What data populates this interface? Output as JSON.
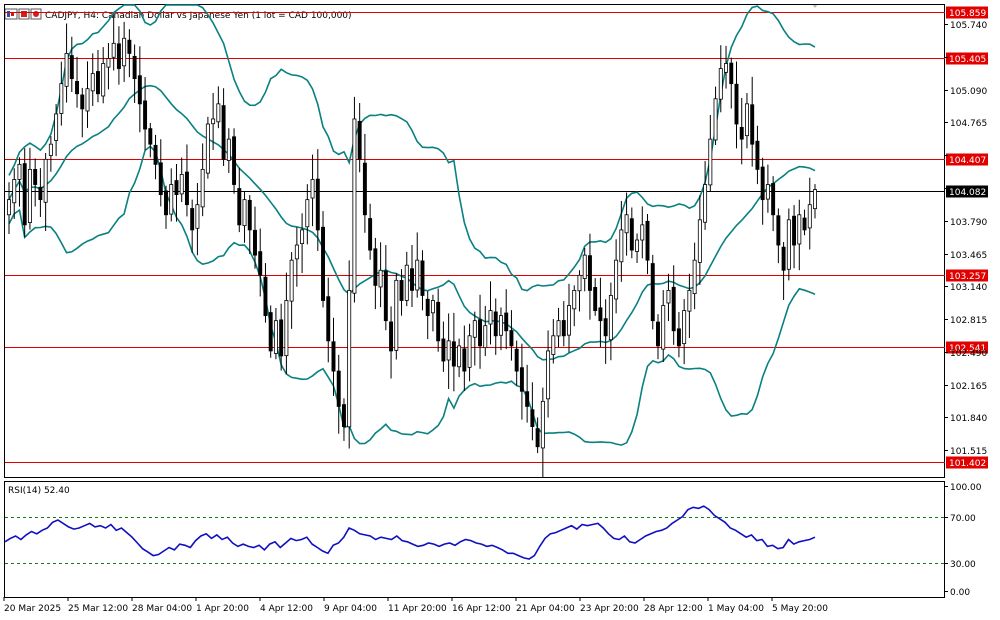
{
  "header": {
    "symbol_title": "CADJPY, H4:  Canadian Dollar vs Japanese Yen (1 lot = CAD 100,000)"
  },
  "colors": {
    "candle": "#000000",
    "bollinger": "#0a8080",
    "level_line": "#e00000",
    "current_price_line": "#000000",
    "rsi_line": "#1010c0",
    "rsi_levels": "#1a7a1a",
    "frame": "#000000"
  },
  "icons": [
    "chart-type-icon",
    "symbol-flag-icon"
  ],
  "chart_data": [
    {
      "type": "candlestick",
      "name": "price",
      "ylim": [
        101.25,
        105.93
      ],
      "yticks": [
        105.74,
        105.415,
        105.09,
        104.765,
        104.44,
        104.115,
        103.79,
        103.465,
        103.14,
        102.815,
        102.49,
        102.165,
        101.84,
        101.515
      ],
      "ytick_labels": [
        "105.740",
        "",
        "105.090",
        "104.765",
        "",
        "",
        "103.790",
        "103.465",
        "103.140",
        "102.815",
        "102.490",
        "102.165",
        "101.840",
        "101.515"
      ],
      "current_price": 104.082,
      "current_price_label": "104.082",
      "horizontal_levels": [
        {
          "value": 105.859,
          "label": "105.859"
        },
        {
          "value": 105.405,
          "label": "105.405"
        },
        {
          "value": 104.407,
          "label": "104.407"
        },
        {
          "value": 103.257,
          "label": "103.257"
        },
        {
          "value": 102.541,
          "label": "102.541"
        },
        {
          "value": 101.402,
          "label": "101.402"
        }
      ],
      "x_labels": [
        "20 Mar 2025",
        "25 Mar 12:00",
        "28 Mar 04:00",
        "1 Apr 20:00",
        "4 Apr 12:00",
        "9 Apr 04:00",
        "11 Apr 20:00",
        "16 Apr 12:00",
        "21 Apr 04:00",
        "23 Apr 20:00",
        "28 Apr 12:00",
        "1 May 04:00",
        "5 May 20:00"
      ],
      "closes": [
        104.0,
        104.2,
        104.35,
        103.75,
        104.3,
        104.15,
        104.0,
        104.4,
        104.55,
        104.85,
        105.15,
        105.45,
        105.2,
        105.05,
        104.9,
        105.1,
        105.25,
        105.05,
        105.35,
        105.4,
        105.55,
        105.3,
        105.6,
        105.45,
        105.2,
        104.95,
        104.7,
        104.55,
        104.35,
        104.05,
        103.85,
        104.15,
        104.05,
        104.25,
        103.95,
        103.7,
        103.95,
        104.3,
        104.75,
        104.8,
        104.95,
        104.4,
        104.6,
        104.15,
        103.75,
        104.0,
        103.7,
        103.45,
        103.25,
        102.85,
        102.5,
        102.8,
        102.45,
        103.0,
        103.4,
        103.55,
        103.7,
        104.0,
        104.2,
        103.7,
        103.0,
        102.6,
        102.3,
        101.95,
        101.75,
        103.1,
        104.8,
        104.4,
        103.85,
        103.5,
        103.15,
        103.3,
        102.8,
        102.5,
        103.2,
        103.0,
        103.35,
        103.1,
        103.4,
        103.05,
        102.85,
        103.0,
        102.6,
        102.4,
        102.6,
        102.35,
        102.55,
        102.3,
        102.65,
        102.8,
        102.55,
        102.75,
        102.9,
        102.65,
        102.85,
        102.7,
        102.55,
        102.3,
        102.1,
        101.95,
        101.75,
        101.55,
        102.0,
        102.5,
        102.65,
        102.8,
        102.65,
        102.95,
        103.1,
        103.25,
        103.45,
        103.1,
        102.9,
        102.8,
        102.65,
        103.05,
        103.4,
        103.7,
        103.85,
        103.5,
        103.6,
        103.75,
        103.4,
        102.8,
        102.55,
        102.95,
        103.1,
        102.7,
        102.55,
        102.9,
        103.1,
        103.4,
        103.8,
        104.15,
        104.6,
        105.0,
        105.3,
        105.35,
        105.15,
        104.75,
        104.6,
        104.95,
        104.55,
        104.3,
        104.0,
        104.15,
        103.85,
        103.55,
        103.3,
        103.8,
        103.55,
        103.85,
        103.7,
        103.95,
        104.1
      ]
    },
    {
      "type": "line",
      "name": "RSI(14)",
      "indicator_label": "RSI(14) 52.40",
      "ylim": [
        0,
        100
      ],
      "yticks": [
        0,
        30,
        70,
        100
      ],
      "ytick_labels": [
        "0.00",
        "30.00",
        "70.00",
        "100.00"
      ],
      "levels": [
        30,
        70
      ],
      "values": [
        48,
        51,
        53,
        50,
        54,
        57,
        55,
        58,
        60,
        65,
        67,
        64,
        61,
        59,
        60,
        62,
        64,
        61,
        62,
        60,
        63,
        58,
        60,
        56,
        52,
        47,
        42,
        39,
        36,
        37,
        40,
        43,
        41,
        46,
        45,
        43,
        49,
        53,
        55,
        51,
        54,
        50,
        52,
        47,
        44,
        46,
        44,
        43,
        45,
        41,
        46,
        48,
        43,
        47,
        51,
        49,
        50,
        52,
        46,
        43,
        40,
        38,
        45,
        47,
        52,
        60,
        58,
        55,
        54,
        53,
        50,
        52,
        51,
        50,
        53,
        49,
        48,
        46,
        44,
        45,
        47,
        46,
        44,
        46,
        47,
        45,
        48,
        50,
        49,
        47,
        46,
        44,
        45,
        43,
        41,
        38,
        38,
        36,
        34,
        33,
        36,
        44,
        51,
        55,
        56,
        58,
        60,
        62,
        59,
        63,
        62,
        63,
        64,
        60,
        55,
        51,
        50,
        53,
        48,
        47,
        50,
        53,
        55,
        57,
        58,
        60,
        64,
        67,
        70,
        76,
        78,
        77,
        79,
        76,
        71,
        68,
        65,
        60,
        58,
        55,
        52,
        54,
        49,
        50,
        44,
        45,
        42,
        43,
        50,
        46,
        48,
        49,
        50,
        52
      ]
    }
  ]
}
